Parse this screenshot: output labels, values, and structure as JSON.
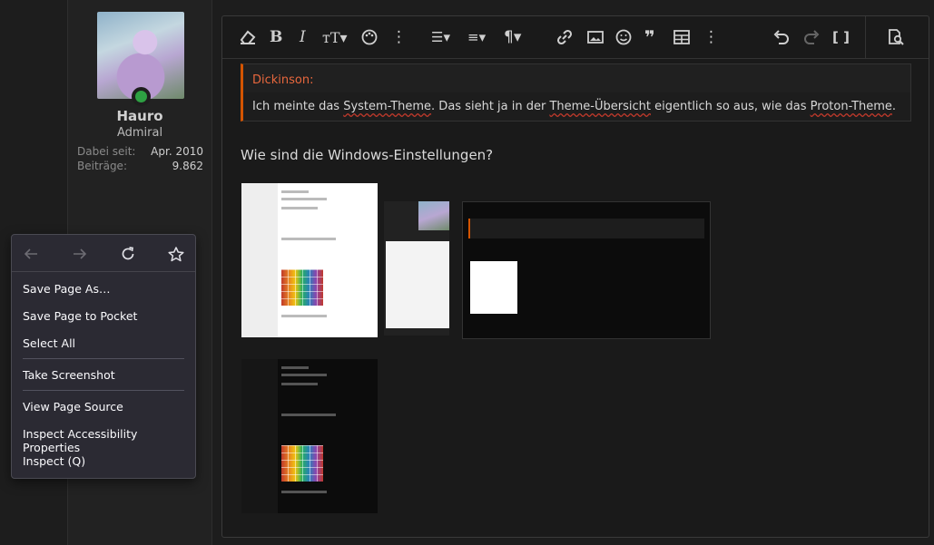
{
  "user": {
    "name": "Hauro",
    "title": "Admiral",
    "stats": [
      {
        "label": "Dabei seit:",
        "value": "Apr. 2010"
      },
      {
        "label": "Beiträge:",
        "value": "9.862"
      }
    ]
  },
  "toolbar": {
    "icons": [
      "eraser-icon",
      "bold-icon",
      "italic-icon",
      "text-size-icon",
      "palette-icon",
      "more-icon",
      "list-icon",
      "align-icon",
      "paragraph-icon",
      "link-icon",
      "image-icon",
      "smiley-icon",
      "quote-icon",
      "table-icon",
      "more-icon",
      "undo-icon",
      "redo-icon",
      "bbcode-icon",
      "preview-icon"
    ]
  },
  "quote": {
    "author": "Dickinson:",
    "text_parts": [
      "Ich meinte das ",
      "System-Theme",
      ". Das sieht ja in der ",
      "Theme-Übersicht",
      " eigentlich so aus, wie das ",
      "Proton-Theme",
      "."
    ]
  },
  "question": "Wie sind die Windows-Einstellungen?",
  "context_menu": {
    "items": [
      {
        "label": "Save Page As…"
      },
      {
        "label": "Save Page to Pocket"
      },
      {
        "label": "Select All"
      },
      {
        "label": "Take Screenshot"
      },
      {
        "label": "View Page Source"
      },
      {
        "label": "Inspect Accessibility Properties"
      },
      {
        "label": "Inspect (Q)"
      }
    ]
  },
  "colors": {
    "accent_quote": "#e8673d",
    "online": "#2ea043",
    "menu_bg": "#2b2a33"
  }
}
